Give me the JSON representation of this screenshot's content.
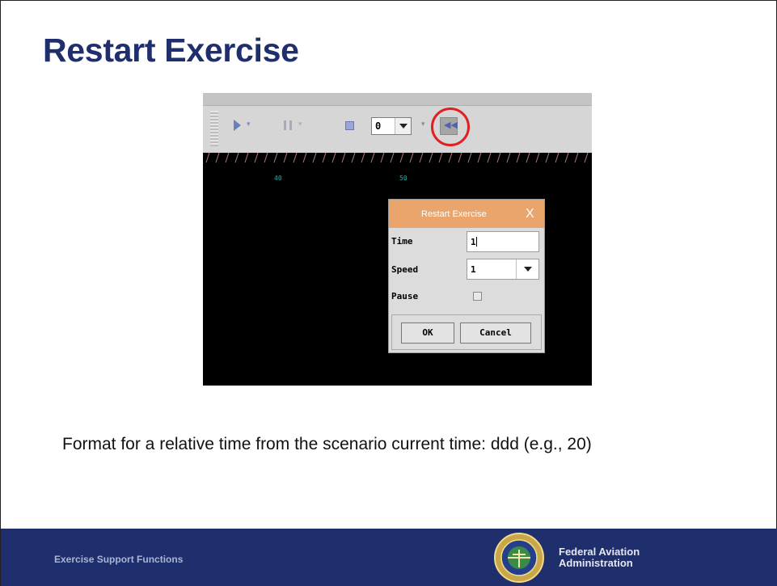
{
  "slide": {
    "title": "Restart Exercise",
    "caption": "Format for a relative time from the scenario current time: ddd (e.g., 20)"
  },
  "toolbar": {
    "speed_value": "0",
    "icons": [
      "play-icon",
      "pause-icon",
      "stop-icon",
      "rewind-restart-icon"
    ]
  },
  "ruler": {
    "labels": [
      "40",
      "50"
    ]
  },
  "dialog": {
    "title": "Restart Exercise",
    "close_label": "X",
    "time_label": "Time",
    "time_value": "1",
    "speed_label": "Speed",
    "speed_value": "1",
    "pause_label": "Pause",
    "pause_checked": false,
    "ok_label": "OK",
    "cancel_label": "Cancel"
  },
  "footer": {
    "left_text": "Exercise Support Functions",
    "org_line1": "Federal Aviation",
    "org_line2": "Administration"
  },
  "colors": {
    "title": "#1f2e6c",
    "footer_bg": "#1f2e6c",
    "dialog_title_bg": "#e9a56c",
    "highlight_circle": "#e02020"
  }
}
